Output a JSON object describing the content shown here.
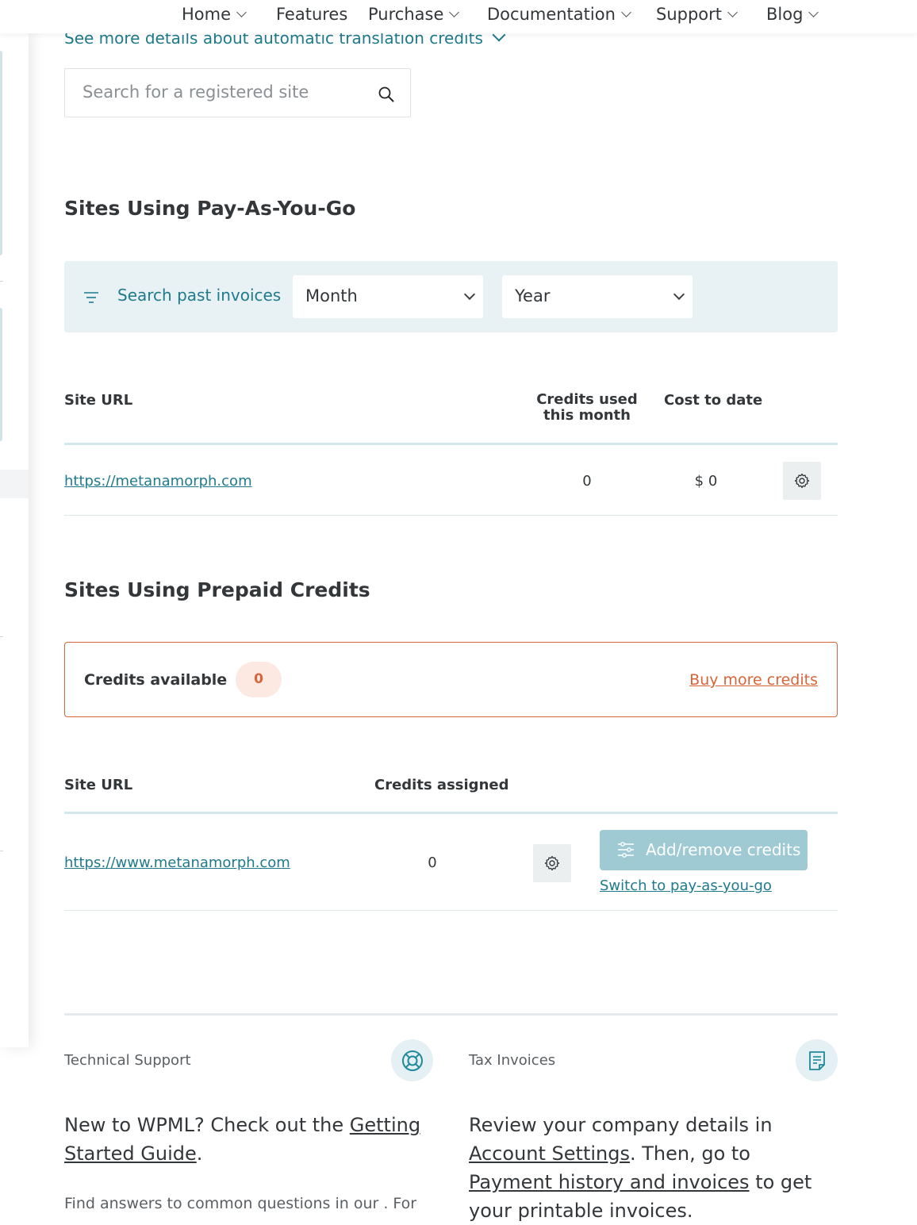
{
  "nav": {
    "items": [
      {
        "label": "Home",
        "has_menu": true
      },
      {
        "label": "Features",
        "has_menu": false
      },
      {
        "label": "Purchase",
        "has_menu": true
      },
      {
        "label": "Documentation",
        "has_menu": true
      },
      {
        "label": "Support",
        "has_menu": true
      },
      {
        "label": "Blog",
        "has_menu": true
      }
    ]
  },
  "see_more_link": "See more details about automatic translation credits",
  "site_search": {
    "placeholder": "Search for a registered site",
    "icon": "search-icon"
  },
  "payg": {
    "heading": "Sites Using Pay-As-You-Go",
    "filter_label": "Search past invoices",
    "month_select": "Month",
    "year_select": "Year",
    "columns": [
      "Site URL",
      "Credits used this month",
      "Cost to date"
    ],
    "rows": [
      {
        "url": "https://metanamorph.com",
        "credits_used": "0",
        "cost": "$ 0"
      }
    ]
  },
  "prepaid": {
    "heading": "Sites Using Prepaid Credits",
    "credits_label": "Credits available",
    "credits_value": "0",
    "buy_link": "Buy more credits",
    "columns": [
      "Site URL",
      "Credits assigned"
    ],
    "rows": [
      {
        "url": "https://www.metanamorph.com",
        "credits_assigned": "0",
        "add_button": "Add/remove credits",
        "switch_link": "Switch to pay-as-you-go"
      }
    ]
  },
  "footer": {
    "support": {
      "title": "Technical Support",
      "icon": "lifebuoy-icon",
      "text_prefix": "New to WPML? Check out the ",
      "text_link": "Getting Started Guide",
      "text_suffix": ".",
      "small": "Find answers to common questions in our . For"
    },
    "tax": {
      "title": "Tax Invoices",
      "icon": "invoice-icon",
      "text_1": "Review your company details in ",
      "link_1": "Account Settings",
      "text_2": ". Then, go to ",
      "link_2": "Payment history and invoices",
      "text_3": " to get your printable invoices."
    }
  },
  "colors": {
    "accent": "#1f7a8c",
    "warning": "#d9643a",
    "filter_bg": "#e8f1f4",
    "button_disabled": "#9fc9d3"
  }
}
